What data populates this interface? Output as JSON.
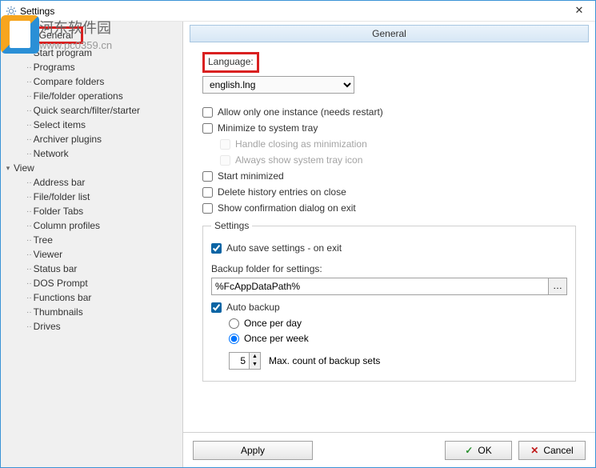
{
  "window": {
    "title": "Settings",
    "close_tooltip": "Close"
  },
  "watermark": {
    "text": "河东软件园",
    "url": "www.pc0359.cn"
  },
  "tree": {
    "items": [
      {
        "label": "General",
        "level": 1,
        "selected": true
      },
      {
        "label": "Start program",
        "level": 1
      },
      {
        "label": "Programs",
        "level": 1
      },
      {
        "label": "Compare folders",
        "level": 1
      },
      {
        "label": "File/folder operations",
        "level": 1
      },
      {
        "label": "Quick search/filter/starter",
        "level": 1
      },
      {
        "label": "Select items",
        "level": 1
      },
      {
        "label": "Archiver plugins",
        "level": 1
      },
      {
        "label": "Network",
        "level": 1
      },
      {
        "label": "View",
        "level": 0,
        "expanded": true
      },
      {
        "label": "Address bar",
        "level": 1
      },
      {
        "label": "File/folder list",
        "level": 1
      },
      {
        "label": "Folder Tabs",
        "level": 1
      },
      {
        "label": "Column profiles",
        "level": 1
      },
      {
        "label": "Tree",
        "level": 1
      },
      {
        "label": "Viewer",
        "level": 1
      },
      {
        "label": "Status bar",
        "level": 1
      },
      {
        "label": "DOS Prompt",
        "level": 1
      },
      {
        "label": "Functions bar",
        "level": 1
      },
      {
        "label": "Thumbnails",
        "level": 1
      },
      {
        "label": "Drives",
        "level": 1
      }
    ]
  },
  "panel": {
    "title": "General",
    "language_label": "Language:",
    "language_value": "english.lng",
    "chk_instance": "Allow only one instance (needs restart)",
    "chk_tray": "Minimize to system tray",
    "chk_tray_sub1": "Handle closing as minimization",
    "chk_tray_sub2": "Always show system tray icon",
    "chk_start_min": "Start minimized",
    "chk_del_history": "Delete history entries on close",
    "chk_confirm_exit": "Show confirmation dialog on exit",
    "settings_group": "Settings",
    "chk_autosave": "Auto save settings - on exit",
    "backup_folder_label": "Backup folder for settings:",
    "backup_folder_value": "%FcAppDataPath%",
    "chk_autobackup": "Auto backup",
    "radio_day": "Once per day",
    "radio_week": "Once per week",
    "spin_value": "5",
    "spin_label": "Max. count of backup sets"
  },
  "footer": {
    "apply": "Apply",
    "ok": "OK",
    "cancel": "Cancel"
  }
}
